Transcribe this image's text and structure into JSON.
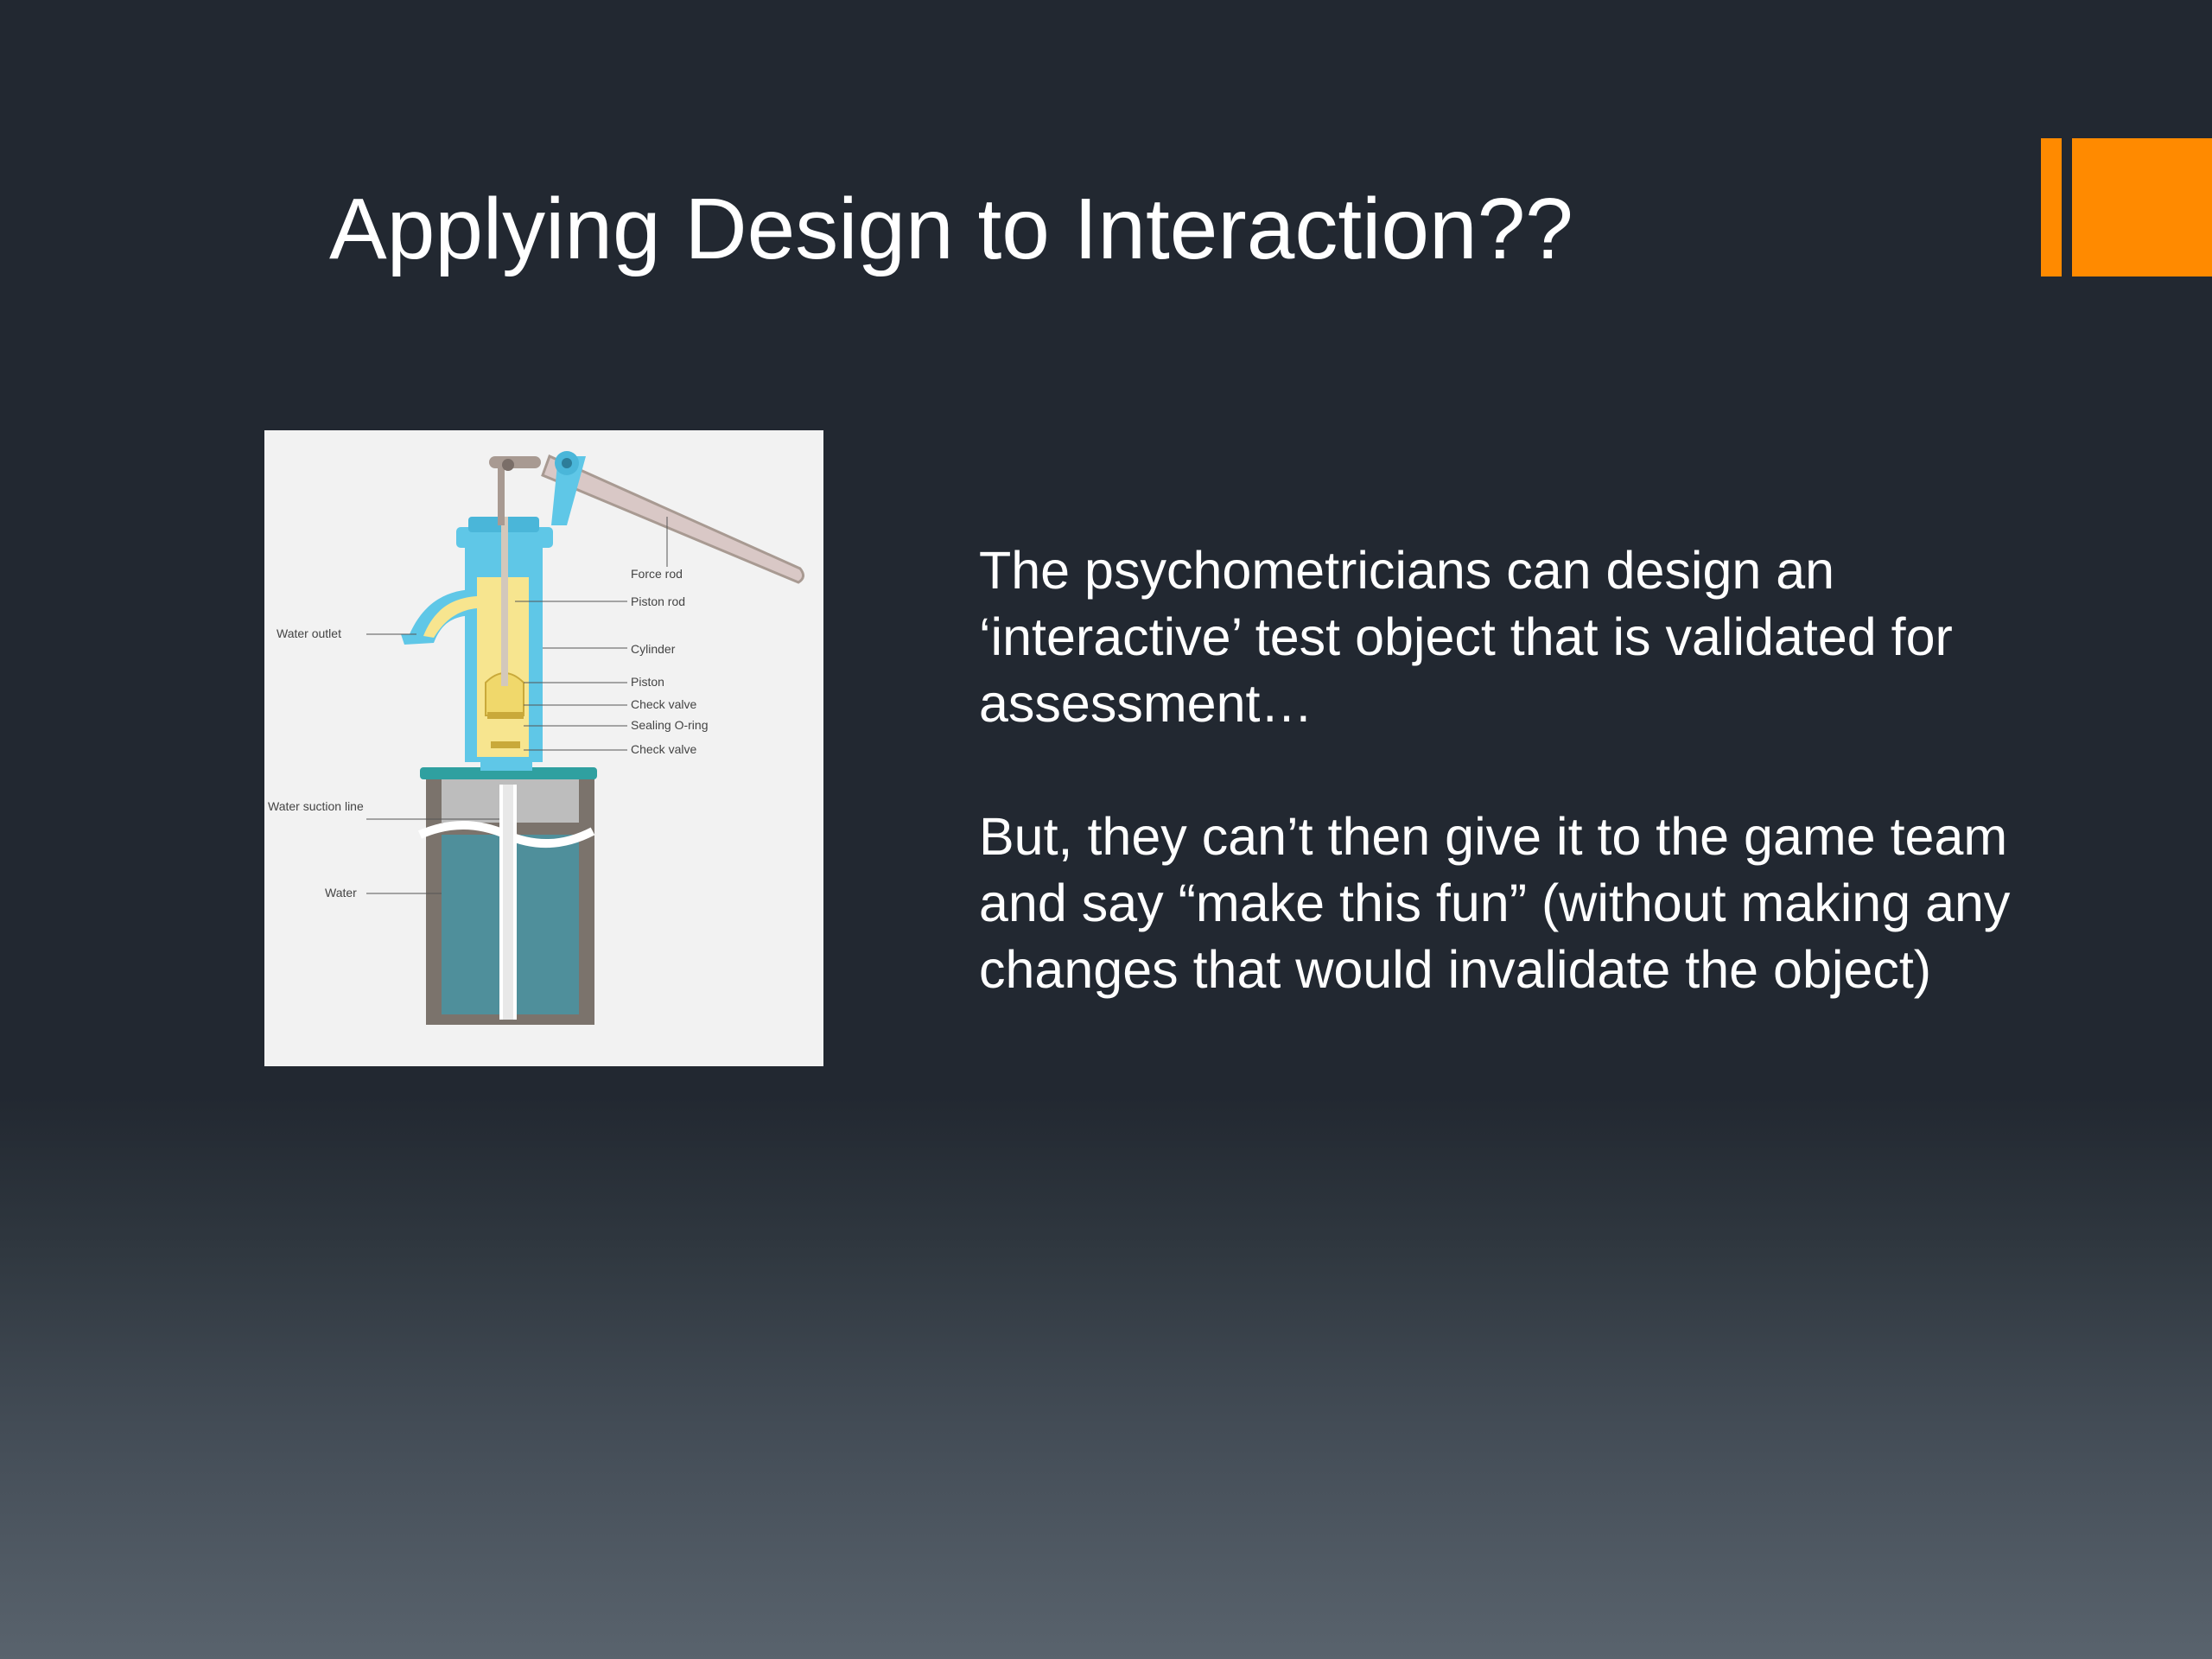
{
  "slide": {
    "title": "Applying Design to Interaction??",
    "accent_color": "#ff8a00",
    "paragraphs": [
      "The psychometricians can design an ‘interactive’ test object that is validated for assessment…",
      "But, they can’t then give it to the game team and say “make this fun” (without making any changes that would invalidate the object)"
    ]
  },
  "diagram": {
    "labels": {
      "force_rod": "Force rod",
      "piston_rod": "Piston rod",
      "water_outlet": "Water outlet",
      "cylinder": "Cylinder",
      "piston": "Piston",
      "check_valve_upper": "Check valve",
      "sealing_o_ring": "Sealing O-ring",
      "check_valve_lower": "Check valve",
      "water_suction_line": "Water suction line",
      "water": "Water"
    }
  }
}
